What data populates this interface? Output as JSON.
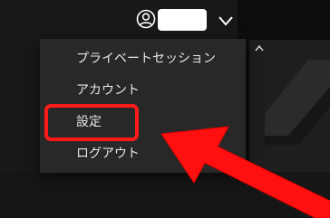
{
  "header": {
    "avatar_icon": "user-circle-icon",
    "username_redacted": true,
    "dropdown_icon": "chevron-down-icon"
  },
  "dropdown": {
    "items": [
      {
        "label": "プライベートセッション"
      },
      {
        "label": "アカウント"
      },
      {
        "label": "設定",
        "highlighted": true
      },
      {
        "label": "ログアウト"
      }
    ]
  },
  "annotation": {
    "highlight_color": "#ff1a1a",
    "arrow_color": "#ff1010",
    "arrow_icon": "pointer-arrow-annotation"
  },
  "colors": {
    "background": "#181818",
    "menu_background": "#282828",
    "menu_text": "#e6e6e6"
  }
}
